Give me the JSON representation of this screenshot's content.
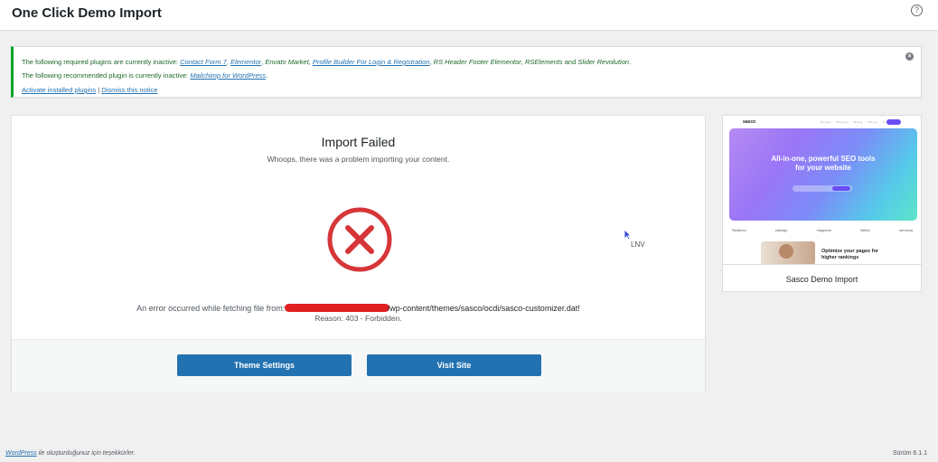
{
  "page": {
    "title": "One Click Demo Import",
    "help_icon": "question-icon"
  },
  "notice": {
    "req_prefix": "The following required plugins are currently inactive: ",
    "req_plugins": [
      "Contact Form 7",
      "Elementor",
      "Envato Market",
      "Profile Builder For Login & Registration",
      "RS Header Footer Elementor",
      "RSElements",
      "Slider Revolution"
    ],
    "rec_prefix": "The following recommended plugin is currently inactive: ",
    "rec_plugin": "Mailchimp for WordPress",
    "activate_label": "Activate installed plugins",
    "separator": "|",
    "dismiss_label": "Dismiss this notice",
    "close_icon": "close-icon"
  },
  "result": {
    "title": "Import Failed",
    "subtitle": "Whoops, there was a problem importing your content.",
    "error_prefix": "An error occurred while fetching file from: ",
    "error_url_tail": "/wp-content/themes/sasco/ocdi/sasco-customizer.dat!",
    "reason": "Reason: 403 - Forbidden.",
    "theme_settings_label": "Theme Settings",
    "visit_site_label": "Visit Site",
    "stray_text": "LNV"
  },
  "demo_card": {
    "caption": "Sasco Demo Import",
    "preview": {
      "brand": "sasco",
      "nav": "Home · Pages · Blog · Shop · Contact",
      "hero_line1": "All-in-one, powerful SEO tools",
      "hero_line2": "for your website",
      "logos": [
        "Redlines",
        "vdesign",
        "Happens",
        "NAKA",
        "servinca"
      ],
      "bottom_line1": "Optimize your pages for",
      "bottom_line2": "higher rankings"
    }
  },
  "footer": {
    "wp_link": "WordPress",
    "thanks": " ile oluşturduğunuz için teşekkürler.",
    "version": "Sürüm 6.1.1"
  },
  "colors": {
    "primary": "#2271b1",
    "error": "#d63638",
    "success": "#00a32a"
  }
}
